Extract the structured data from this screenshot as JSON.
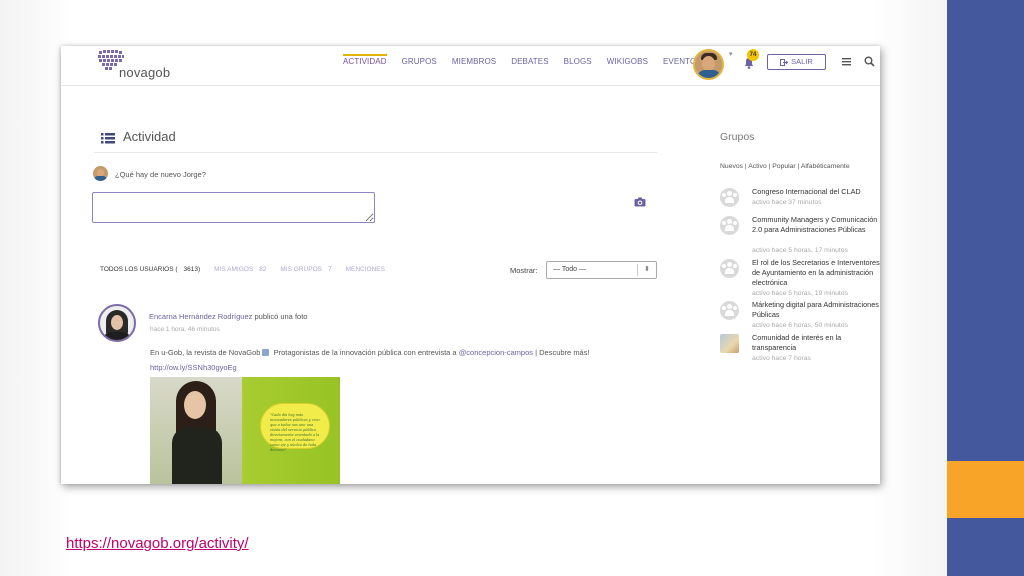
{
  "slide": {
    "url": "https://novagob.org/activity/",
    "colors": {
      "band": "#44599d",
      "accent": "#f7a428",
      "link": "#c0006e"
    }
  },
  "header": {
    "logo_text": "novagob",
    "nav": [
      {
        "label": "ACTIVIDAD",
        "active": true
      },
      {
        "label": "GRUPOS"
      },
      {
        "label": "MIEMBROS"
      },
      {
        "label": "DEBATES"
      },
      {
        "label": "BLOGS"
      },
      {
        "label": "WIKIGOBS"
      },
      {
        "label": "EVENTOS"
      }
    ],
    "notification_count": "74",
    "salir_label": "SALIR",
    "icons": [
      "menu-icon",
      "search-icon",
      "bell-icon",
      "sign-out-icon"
    ]
  },
  "activity": {
    "title": "Actividad",
    "prompt": "¿Qué hay de nuevo Jorge?",
    "post_value": "",
    "filters": [
      {
        "label": "TODOS LOS USUARIOS (",
        "count": "3613)"
      },
      {
        "label": "MIS AMIGOS",
        "count": "82"
      },
      {
        "label": "MIS GRUPOS",
        "count": "7"
      },
      {
        "label": "MENCIONES",
        "count": ""
      }
    ],
    "mostrar_label": "Mostrar:",
    "mostrar_value": "— Todo —",
    "item": {
      "author": "Encarna Hernández Rodríguez",
      "action": " publicó una foto",
      "time": "hace 1 hora, 46 minutos",
      "text_prefix": "En u-Gob, la revista de NovaGob",
      "text_mid": " Protagonistas de la innovación pública con entrevista a ",
      "mention": "@concepcion-campos",
      "text_suffix": " | Descubre más!",
      "link": "http://ow.ly/SSNh30gyoEg",
      "photo_quote": "\"Cada día hay más innovadores públicos y creo que a todos nos une una visión del servicio público directamente orientado a la mejora, con el ciudadano como eje y núcleo de toda decisión\""
    }
  },
  "sidebar": {
    "title": "Grupos",
    "filters": "Nuevos | Activo | Popular | Alfabéticamente",
    "groups": [
      {
        "name": "Congreso Internacional del CLAD",
        "meta": "activo hace 37 minutos"
      },
      {
        "name": "Community Managers y Comunicación 2.0 para Administraciones Públicas",
        "meta": "activo hace 5 horas, 17 minutos"
      },
      {
        "name": "El rol de los Secretarios e Interventores de Ayuntamiento en la administración electrónica",
        "meta": "activo hace 5 horas, 19 minutos"
      },
      {
        "name": "Márketing digital para Administraciones Públicas",
        "meta": "activo hace 6 horas, 50 minutos"
      },
      {
        "name": "Comunidad de interés en la transparencia",
        "meta": "activo hace 7 horas"
      }
    ]
  }
}
